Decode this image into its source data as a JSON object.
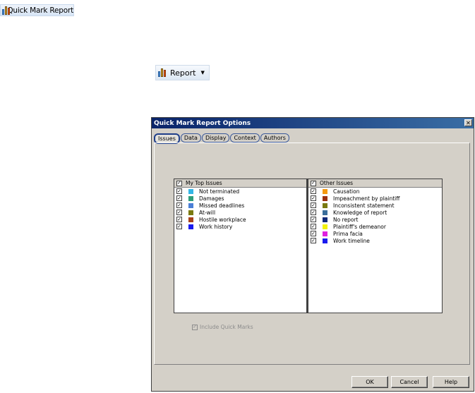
{
  "toolbar": {
    "quick_mark_report_label": "Quick Mark Report",
    "report_label": "Report",
    "report_icon": "bar-chart-icon",
    "dropdown_icon": "chevron-down-icon"
  },
  "dialog": {
    "title": "Quick Mark Report Options",
    "close_glyph": "✕",
    "tabs": [
      {
        "label": "Issues",
        "active": true
      },
      {
        "label": "Data",
        "active": false
      },
      {
        "label": "Display",
        "active": false
      },
      {
        "label": "Context",
        "active": false
      },
      {
        "label": "Authors",
        "active": false
      }
    ],
    "top_issues": {
      "header": "My Top Issues",
      "items": [
        {
          "label": "Not terminated",
          "color": "#33b5e5",
          "checked": true
        },
        {
          "label": "Damages",
          "color": "#2e9e7a",
          "checked": true
        },
        {
          "label": "Missed deadlines",
          "color": "#4a7fd6",
          "checked": true
        },
        {
          "label": "At-will",
          "color": "#7a7a10",
          "checked": true
        },
        {
          "label": "Hostile workplace",
          "color": "#a8421a",
          "checked": true
        },
        {
          "label": "Work history",
          "color": "#1a1aee",
          "checked": true
        }
      ]
    },
    "other_issues": {
      "header": "Other Issues",
      "items": [
        {
          "label": "Causation",
          "color": "#f59a10",
          "checked": true
        },
        {
          "label": "Impeachment by plaintiff",
          "color": "#9a3010",
          "checked": true
        },
        {
          "label": "Inconsistent statement",
          "color": "#7a7a10",
          "checked": true
        },
        {
          "label": "Knowledge of report",
          "color": "#3a6e9a",
          "checked": true
        },
        {
          "label": "No report",
          "color": "#102a78",
          "checked": true
        },
        {
          "label": "Plaintiff's demeanor",
          "color": "#f2f20a",
          "checked": true
        },
        {
          "label": "Prima facia",
          "color": "#e020e0",
          "checked": true
        },
        {
          "label": "Work timeline",
          "color": "#1a1aee",
          "checked": true
        }
      ]
    },
    "include_quick_marks_label": "Include Quick Marks",
    "buttons": {
      "ok": "OK",
      "cancel": "Cancel",
      "help": "Help"
    }
  }
}
